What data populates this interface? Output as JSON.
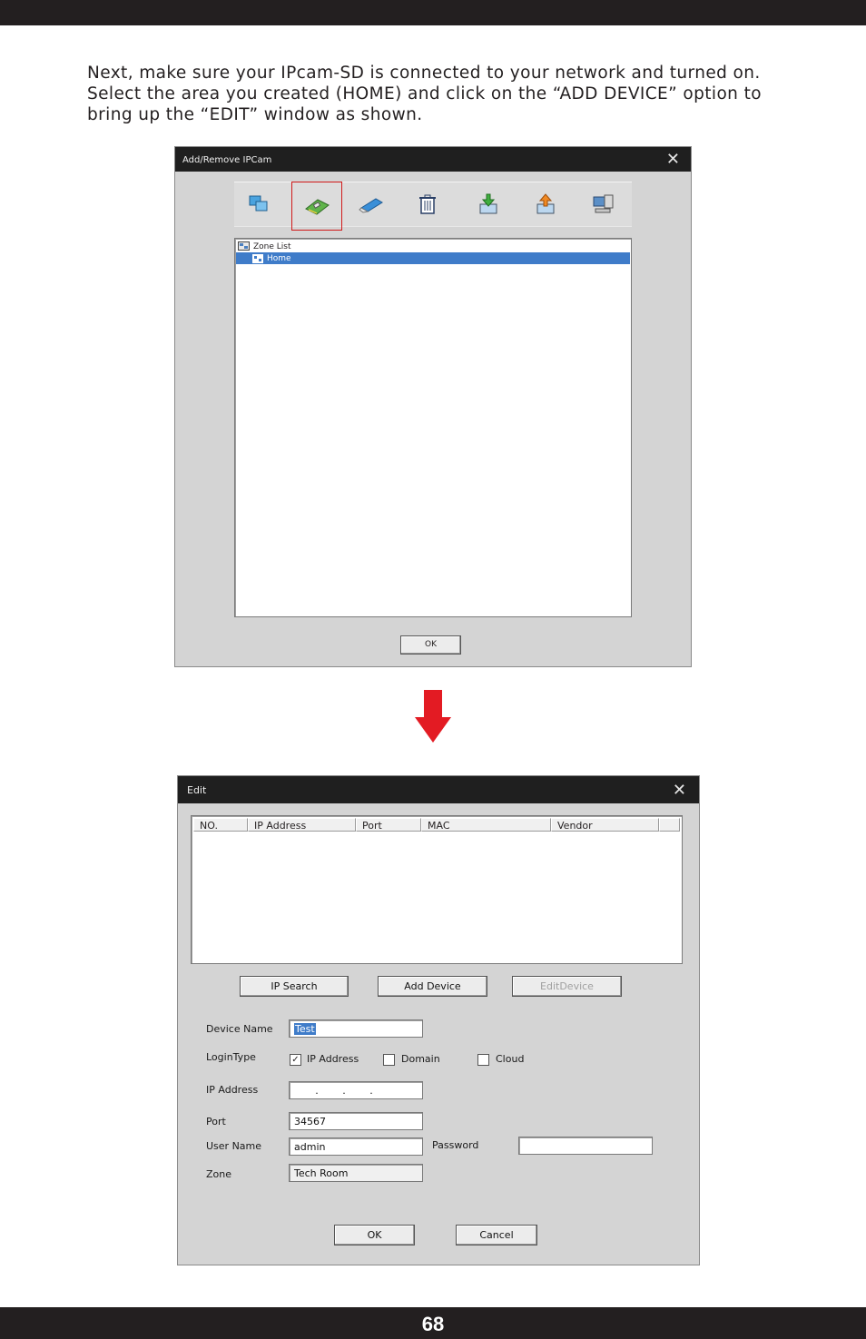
{
  "intro": {
    "line1": "Next, make sure your IPcam-SD is connected to your network and turned on.",
    "line2": "Select the area you created (HOME) and click on the “ADD DEVICE” option to",
    "line3": "bring up the “EDIT” window as shown."
  },
  "window1": {
    "title": "Add/Remove IPCam",
    "close": "✕",
    "toolbar_icons": [
      "add-zone-icon",
      "add-device-icon",
      "edit-icon",
      "trash-icon",
      "import-icon",
      "export-icon",
      "network-icon"
    ],
    "tree": {
      "root": "Zone List",
      "child": "Home"
    },
    "ok": "OK"
  },
  "window2": {
    "title": "Edit",
    "close": "✕",
    "columns": [
      "NO.",
      "IP Address",
      "Port",
      "MAC",
      "Vendor"
    ],
    "buttons": {
      "ip_search": "IP Search",
      "add_device": "Add Device",
      "edit_device": "EditDevice"
    },
    "labels": {
      "device_name": "Device Name",
      "login_type": "LoginType",
      "ip_address": "IP Address",
      "port": "Port",
      "user_name": "User Name",
      "password": "Password",
      "zone": "Zone"
    },
    "login_options": {
      "ip": "IP Address",
      "domain": "Domain",
      "cloud": "Cloud"
    },
    "values": {
      "device_name": "Test",
      "port": "34567",
      "user_name": "admin",
      "password": "",
      "zone": "Tech Room",
      "ip_dots": "."
    },
    "ok": "OK",
    "cancel": "Cancel"
  },
  "footer": {
    "page": "68"
  },
  "colors": {
    "bar": "#231f20",
    "arrow": "#e31b23",
    "selection": "#3f7cc9"
  }
}
